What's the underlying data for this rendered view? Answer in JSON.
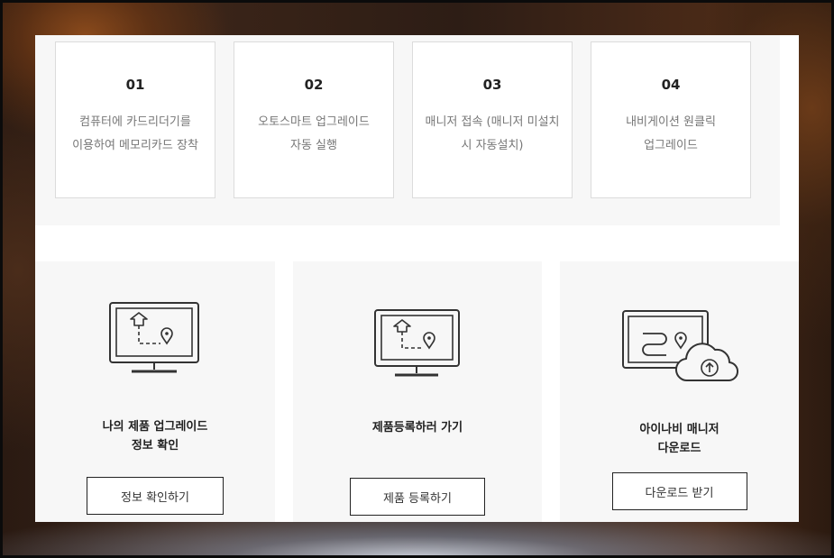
{
  "steps": [
    {
      "number": "01",
      "desc": "컴퓨터에 카드리더기를 이용하여 메모리카드 장착"
    },
    {
      "number": "02",
      "desc": "오토스마트 업그레이드 자동 실행"
    },
    {
      "number": "03",
      "desc": "매니저 접속 (매니저 미설치 시 자동설치)"
    },
    {
      "number": "04",
      "desc": "내비게이션 원클릭 업그레이드"
    }
  ],
  "cards": [
    {
      "title_line1": "나의 제품 업그레이드",
      "title_line2": "정보 확인",
      "button": "정보 확인하기",
      "icon": "monitor-route-icon"
    },
    {
      "title_line1": "제품등록하러 가기",
      "title_line2": "",
      "button": "제품 등록하기",
      "icon": "monitor-route-icon"
    },
    {
      "title_line1": "아이나비 매니저",
      "title_line2": "다운로드",
      "button": "다운로드 받기",
      "icon": "cloud-upload-icon"
    }
  ],
  "colors": {
    "text": "#222222",
    "muted": "#777777",
    "panel": "#f7f7f7",
    "border": "#dcdcdc"
  }
}
